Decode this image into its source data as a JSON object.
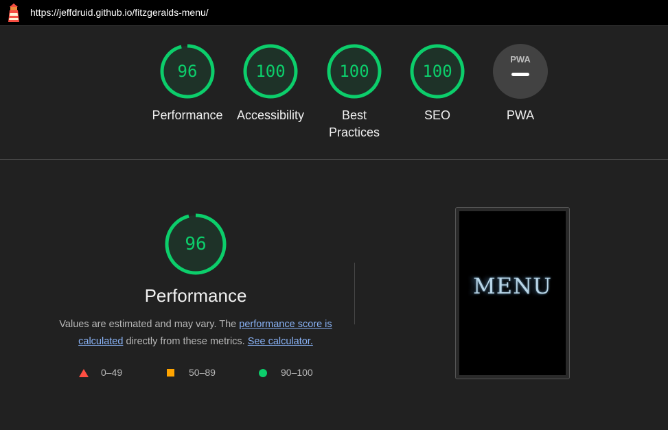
{
  "header": {
    "url": "https://jeffdruid.github.io/fitzgeralds-menu/",
    "logo_icon": "lighthouse-icon"
  },
  "gauges": [
    {
      "id": "performance",
      "score": "96",
      "fraction": 0.96,
      "label": "Performance"
    },
    {
      "id": "accessibility",
      "score": "100",
      "fraction": 1.0,
      "label": "Accessibility"
    },
    {
      "id": "best-practices",
      "score": "100",
      "fraction": 1.0,
      "label": "Best Practices"
    },
    {
      "id": "seo",
      "score": "100",
      "fraction": 1.0,
      "label": "SEO"
    },
    {
      "id": "pwa",
      "score": "",
      "fraction": 0,
      "label": "PWA",
      "badge": "PWA",
      "icon": "pwa-icon"
    }
  ],
  "performance": {
    "score": "96",
    "fraction": 0.96,
    "title": "Performance",
    "desc_before": "Values are estimated and may vary. The ",
    "link_score": "performance score is calculated",
    "desc_middle": " directly from these metrics. ",
    "link_calc": "See calculator."
  },
  "legend": {
    "fail": "0–49",
    "average": "50–89",
    "pass": "90–100"
  },
  "screenshot": {
    "text": "MENU"
  },
  "colors": {
    "pass": "#0cce6b",
    "average": "#ffa400",
    "fail": "#ff4e42",
    "background": "#212121",
    "link": "#8ab4f8"
  }
}
